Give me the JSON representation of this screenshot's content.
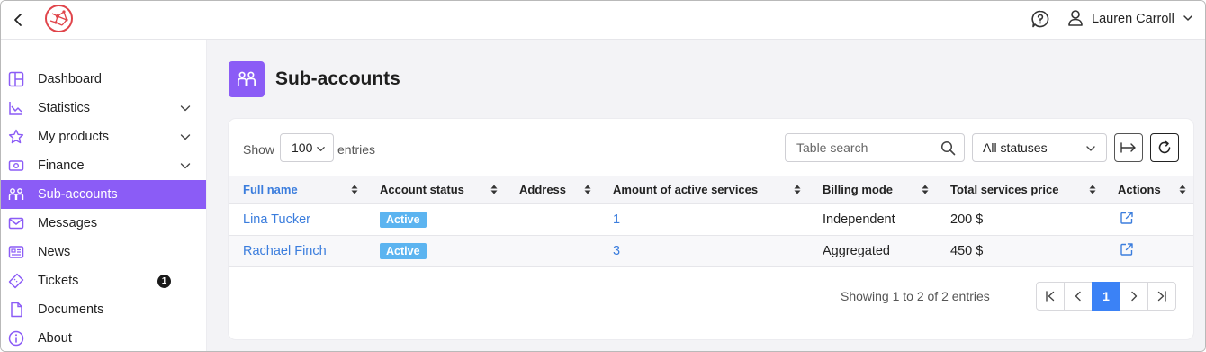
{
  "header": {
    "user_name": "Lauren Carroll"
  },
  "sidebar": {
    "items": [
      {
        "label": "Dashboard"
      },
      {
        "label": "Statistics"
      },
      {
        "label": "My products"
      },
      {
        "label": "Finance"
      },
      {
        "label": "Sub-accounts"
      },
      {
        "label": "Messages"
      },
      {
        "label": "News"
      },
      {
        "label": "Tickets",
        "badge": "1"
      },
      {
        "label": "Documents"
      },
      {
        "label": "About"
      }
    ]
  },
  "page": {
    "title": "Sub-accounts"
  },
  "toolbar": {
    "show_label": "Show",
    "entries_value": "100",
    "entries_label": "entries",
    "search_placeholder": "Table search",
    "status_value": "All statuses"
  },
  "table": {
    "columns": [
      "Full name",
      "Account status",
      "Address",
      "Amount of active services",
      "Billing mode",
      "Total services price",
      "Actions"
    ],
    "rows": [
      {
        "full_name": "Lina Tucker",
        "status": "Active",
        "address": "",
        "active_services": "1",
        "billing_mode": "Independent",
        "total_price": "200 $"
      },
      {
        "full_name": "Rachael Finch",
        "status": "Active",
        "address": "",
        "active_services": "3",
        "billing_mode": "Aggregated",
        "total_price": "450 $"
      }
    ]
  },
  "footer": {
    "info": "Showing 1 to 2 of 2 entries",
    "current_page": "1"
  },
  "colors": {
    "accent": "#8b5cf6",
    "link": "#3b7ddd",
    "status_active": "#5cb4f0",
    "page_active": "#3b82f6"
  }
}
